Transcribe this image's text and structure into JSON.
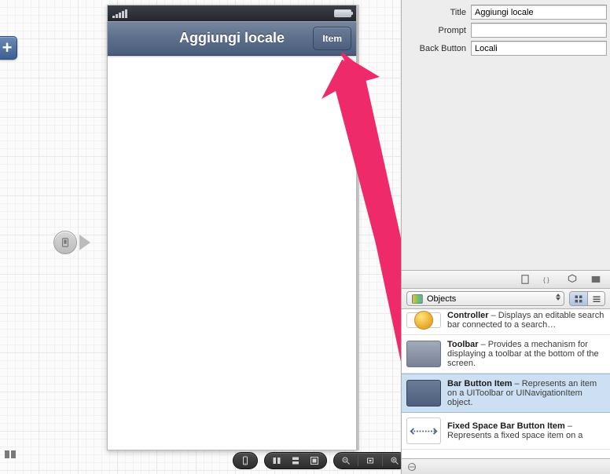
{
  "inspector": {
    "title_label": "Title",
    "title_value": "Aggiungi locale",
    "prompt_label": "Prompt",
    "prompt_value": "",
    "backbutton_label": "Back Button",
    "backbutton_value": "Locali"
  },
  "navbar": {
    "title": "Aggiungi locale",
    "right_item": "Item"
  },
  "library": {
    "popup_label": "Objects",
    "items": [
      {
        "name": "Controller",
        "desc": " – Displays an editable search bar connected to a search…"
      },
      {
        "name": "Toolbar",
        "desc": " – Provides a mechanism for displaying a toolbar at the bottom of the screen."
      },
      {
        "name": "Bar Button Item",
        "desc": " – Represents an item on a UIToolbar or UINavigationItem object."
      },
      {
        "name": "Fixed Space Bar Button Item",
        "desc": " – Represents a fixed space item on a"
      }
    ]
  }
}
